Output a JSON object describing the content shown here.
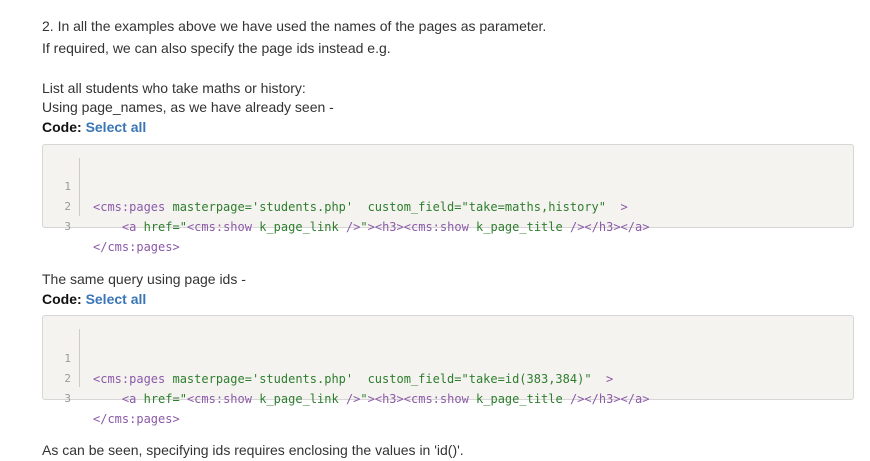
{
  "intro": {
    "line1": "2. In all the examples above we have used the names of the pages as parameter.",
    "line2": "If required, we can also specify the page ids instead e.g."
  },
  "section1": {
    "line1": "List all students who take maths or history:",
    "line2": "Using page_names, as we have already seen -",
    "code_label": "Code:",
    "select_all": "Select all",
    "code": {
      "line_numbers": [
        "1",
        "2",
        "3"
      ],
      "l1": {
        "open": "<cms:pages",
        "attr1": "masterpage=",
        "val1": "'students.php'",
        "attr2": "custom_field=",
        "val2": "\"take=maths,history\"",
        "close": ">"
      },
      "l2": {
        "a_open": "<a",
        "href_attr": "href=",
        "href_q1": "\"",
        "show1": "<cms:show",
        "show1_arg": "k_page_link",
        "show1_close": "/>",
        "href_q2": "\"",
        "gt": ">",
        "h3_open": "<h3>",
        "show2": "<cms:show",
        "show2_arg": "k_page_title",
        "show2_close": "/>",
        "h3_close": "</h3>",
        "a_close": "</a>"
      },
      "l3": "</cms:pages>"
    }
  },
  "section2": {
    "line1": "The same query using page ids -",
    "code_label": "Code:",
    "select_all": "Select all",
    "code": {
      "line_numbers": [
        "1",
        "2",
        "3"
      ],
      "l1": {
        "open": "<cms:pages",
        "attr1": "masterpage=",
        "val1": "'students.php'",
        "attr2": "custom_field=",
        "val2": "\"take=id(383,384)\"",
        "close": ">"
      },
      "l2": {
        "a_open": "<a",
        "href_attr": "href=",
        "href_q1": "\"",
        "show1": "<cms:show",
        "show1_arg": "k_page_link",
        "show1_close": "/>",
        "href_q2": "\"",
        "gt": ">",
        "h3_open": "<h3>",
        "show2": "<cms:show",
        "show2_arg": "k_page_title",
        "show2_close": "/>",
        "h3_close": "</h3>",
        "a_close": "</a>"
      },
      "l3": "</cms:pages>"
    }
  },
  "outro": {
    "line1": "As can be seen, specifying ids requires enclosing the values in 'id()'."
  }
}
